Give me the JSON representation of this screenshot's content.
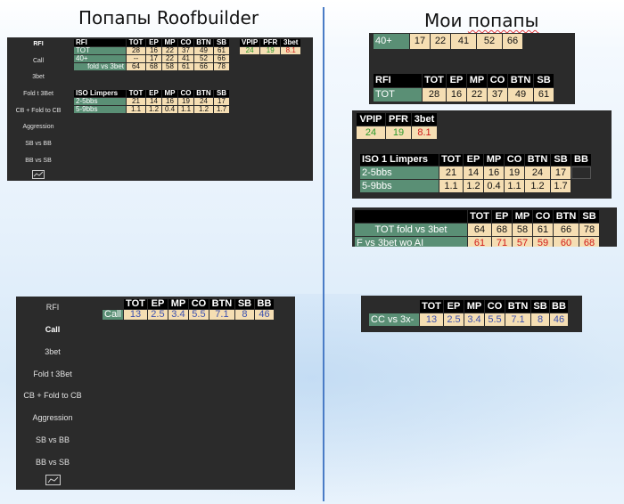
{
  "titles": {
    "left": "Попапы Roofbuilder",
    "right_prefix": "Мои ",
    "right_word": "попапы"
  },
  "sidebar": {
    "items": [
      "RFI",
      "Call",
      "3bet",
      "Fold t 3Bet",
      "CB + Fold to CB",
      "Aggression",
      "SB vs BB",
      "BB vs SB"
    ],
    "items_short": [
      "RFI",
      "Call",
      "3bet",
      "Fold t 3Bet",
      "CB + Fold to CB",
      "Aggression",
      "SB vs BB",
      "BB vs SB"
    ],
    "chart_icon": "line-chart-icon"
  },
  "rfi_table": {
    "headers": [
      "RFI",
      "TOT",
      "EP",
      "MP",
      "CO",
      "BTN",
      "SB"
    ],
    "rows": [
      {
        "label": "TOT",
        "values": [
          "28",
          "16",
          "22",
          "37",
          "49",
          "61"
        ]
      },
      {
        "label": "40+",
        "values": [
          "--",
          "17",
          "22",
          "41",
          "52",
          "66"
        ]
      },
      {
        "label": "fold vs 3bet",
        "values": [
          "64",
          "68",
          "58",
          "61",
          "66",
          "78"
        ]
      }
    ]
  },
  "vpip_table": {
    "headers": [
      "VPIP",
      "PFR",
      "3bet"
    ],
    "values": [
      "24",
      "19",
      "8.1"
    ]
  },
  "iso_table": {
    "headers": [
      "ISO Limpers",
      "TOT",
      "EP",
      "MP",
      "CO",
      "BTN",
      "SB"
    ],
    "rows": [
      {
        "label": "2-5bbs",
        "values": [
          "21",
          "14",
          "16",
          "19",
          "24",
          "17"
        ]
      },
      {
        "label": "5-9bbs",
        "values": [
          "1.1",
          "1.2",
          "0.4",
          "1.1",
          "1.2",
          "1.7"
        ]
      }
    ]
  },
  "call_table": {
    "headers": [
      "TOT",
      "EP",
      "MP",
      "CO",
      "BTN",
      "SB",
      "BB"
    ],
    "label": "Call",
    "values": [
      "13",
      "2.5",
      "3.4",
      "5.5",
      "7.1",
      "8",
      "46"
    ]
  },
  "my_rfi": {
    "row40": {
      "label": "40+",
      "values": [
        "17",
        "22",
        "41",
        "52",
        "66"
      ]
    },
    "headers": [
      "RFI",
      "TOT",
      "EP",
      "MP",
      "CO",
      "BTN",
      "SB"
    ],
    "tot": {
      "label": "TOT",
      "values": [
        "28",
        "16",
        "22",
        "37",
        "49",
        "61"
      ]
    }
  },
  "my_vpip": {
    "headers": [
      "VPIP",
      "PFR",
      "3bet"
    ],
    "values": [
      "24",
      "19",
      "8.1"
    ]
  },
  "my_iso": {
    "headers": [
      "ISO 1 Limpers",
      "TOT",
      "EP",
      "MP",
      "CO",
      "BTN",
      "SB",
      "BB"
    ],
    "rows": [
      {
        "label": "2-5bbs",
        "values": [
          "21",
          "14",
          "16",
          "19",
          "24",
          "17",
          ""
        ]
      },
      {
        "label": "5-9bbs",
        "values": [
          "1.1",
          "1.2",
          "0.4",
          "1.1",
          "1.2",
          "1.7",
          ""
        ]
      }
    ]
  },
  "my_fold3bet": {
    "headers": [
      "TOT",
      "EP",
      "MP",
      "CO",
      "BTN",
      "SB"
    ],
    "rows": [
      {
        "label": "TOT fold vs 3bet",
        "values": [
          "64",
          "68",
          "58",
          "61",
          "66",
          "78"
        ]
      },
      {
        "label": "F vs 3bet wo AI",
        "values": [
          "61",
          "71",
          "57",
          "59",
          "60",
          "68"
        ]
      }
    ]
  },
  "my_cc": {
    "headers": [
      "TOT",
      "EP",
      "MP",
      "CO",
      "BTN",
      "SB",
      "BB"
    ],
    "label": "CC vs 3x-",
    "values": [
      "13",
      "2.5",
      "3.4",
      "5.5",
      "7.1",
      "8",
      "46"
    ]
  },
  "colors": {
    "panel": "#2b2b2b",
    "green": "#5a8f75",
    "tan": "#f5deb3",
    "header": "#000000",
    "divider": "#4a7cc6"
  }
}
